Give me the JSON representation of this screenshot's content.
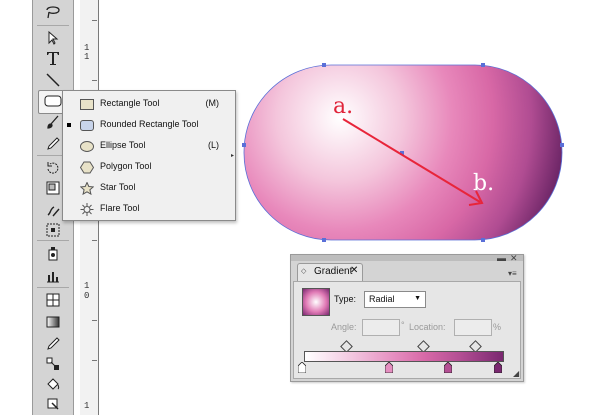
{
  "ruler": {
    "numbers": [
      "1",
      "1",
      "1",
      "1",
      "1",
      "0",
      "1"
    ]
  },
  "flyout": {
    "items": [
      {
        "label": "Rectangle Tool",
        "shortcut": "(M)",
        "icon": "rectangle-icon"
      },
      {
        "label": "Rounded Rectangle Tool",
        "shortcut": "",
        "icon": "rounded-rectangle-icon",
        "selected": true
      },
      {
        "label": "Ellipse Tool",
        "shortcut": "(L)",
        "icon": "ellipse-icon"
      },
      {
        "label": "Polygon Tool",
        "shortcut": "",
        "icon": "polygon-icon"
      },
      {
        "label": "Star Tool",
        "shortcut": "",
        "icon": "star-icon"
      },
      {
        "label": "Flare Tool",
        "shortcut": "",
        "icon": "flare-icon"
      }
    ]
  },
  "canvas": {
    "label_a": "a.",
    "label_b": "b.",
    "arrow_color": "#e8253a"
  },
  "gradient_panel": {
    "tab_label": "Gradient",
    "close_glyph": "✕",
    "type_label": "Type:",
    "type_value": "Radial",
    "angle_label": "Angle:",
    "degree_unit": "°",
    "location_label": "Location:",
    "percent_unit": "%",
    "stop_colors": [
      "#ffffff",
      "#e58ec0",
      "#b44f94",
      "#7a2870"
    ]
  }
}
